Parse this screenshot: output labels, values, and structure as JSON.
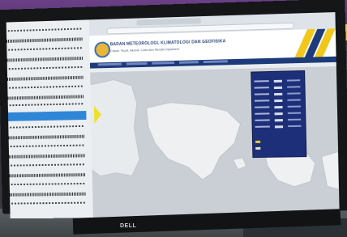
{
  "scene": {
    "description_visible": "",
    "monitor_brand": "DELL"
  },
  "site": {
    "title": "BADAN METEOROLOGI, KLIMATOLOGI DAN GEOFISIKA",
    "subtitle": "Cepat, Tepat, Akurat, Luas dan Mudah Dipahami"
  },
  "colors": {
    "header_blue": "#1d3a7a",
    "legend_blue": "#1e2f7a",
    "selection_blue": "#2f86d6",
    "accent_yellow": "#f0e02a"
  },
  "icons": {
    "site_logo": "bmkg-logo",
    "map_pointer": "triangle-pointer"
  }
}
